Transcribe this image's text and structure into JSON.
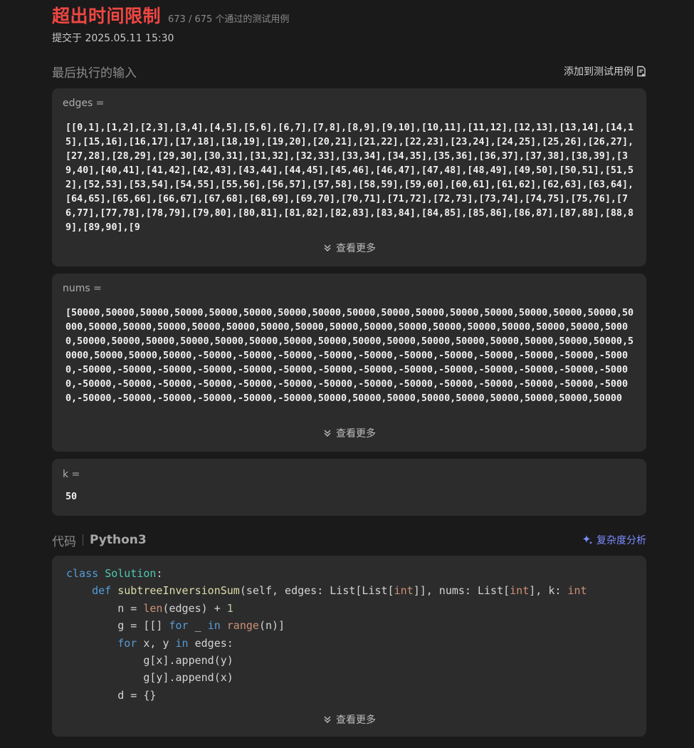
{
  "header": {
    "verdict": "超出时间限制",
    "passed": "673 / 675 个通过的测试用例",
    "submitted": "提交于 2025.05.11 15:30"
  },
  "input_section": {
    "title": "最后执行的输入",
    "add_to_tests": "添加到测试用例",
    "see_more": "查看更多",
    "vars": [
      {
        "label": "edges =",
        "value": "[[0,1],[1,2],[2,3],[3,4],[4,5],[5,6],[6,7],[7,8],[8,9],[9,10],[10,11],[11,12],[12,13],[13,14],[14,15],[15,16],[16,17],[17,18],[18,19],[19,20],[20,21],[21,22],[22,23],[23,24],[24,25],[25,26],[26,27],[27,28],[28,29],[29,30],[30,31],[31,32],[32,33],[33,34],[34,35],[35,36],[36,37],[37,38],[38,39],[39,40],[40,41],[41,42],[42,43],[43,44],[44,45],[45,46],[46,47],[47,48],[48,49],[49,50],[50,51],[51,52],[52,53],[53,54],[54,55],[55,56],[56,57],[57,58],[58,59],[59,60],[60,61],[61,62],[62,63],[63,64],[64,65],[65,66],[66,67],[67,68],[68,69],[69,70],[70,71],[71,72],[72,73],[73,74],[74,75],[75,76],[76,77],[77,78],[78,79],[79,80],[80,81],[81,82],[82,83],[83,84],[84,85],[85,86],[86,87],[87,88],[88,89],[89,90],[9"
      },
      {
        "label": "nums =",
        "value": "[50000,50000,50000,50000,50000,50000,50000,50000,50000,50000,50000,50000,50000,50000,50000,50000,50000,50000,50000,50000,50000,50000,50000,50000,50000,50000,50000,50000,50000,50000,50000,50000,50000,50000,50000,50000,50000,50000,50000,50000,50000,50000,50000,50000,50000,50000,50000,50000,50000,50000,50000,50000,50000,-50000,-50000,-50000,-50000,-50000,-50000,-50000,-50000,-50000,-50000,-50000,-50000,-50000,-50000,-50000,-50000,-50000,-50000,-50000,-50000,-50000,-50000,-50000,-50000,-50000,-50000,-50000,-50000,-50000,-50000,-50000,-50000,-50000,-50000,-50000,-50000,-50000,-50000,-50000,-50000,-50000,-50000,-50000,-50000,-50000,50000,50000,50000,50000,50000,50000,50000,50000,50000"
      },
      {
        "label": "k =",
        "value": "50"
      }
    ]
  },
  "code_section": {
    "title": "代码",
    "language": "Python3",
    "analysis": "复杂度分析",
    "see_more": "查看更多"
  }
}
